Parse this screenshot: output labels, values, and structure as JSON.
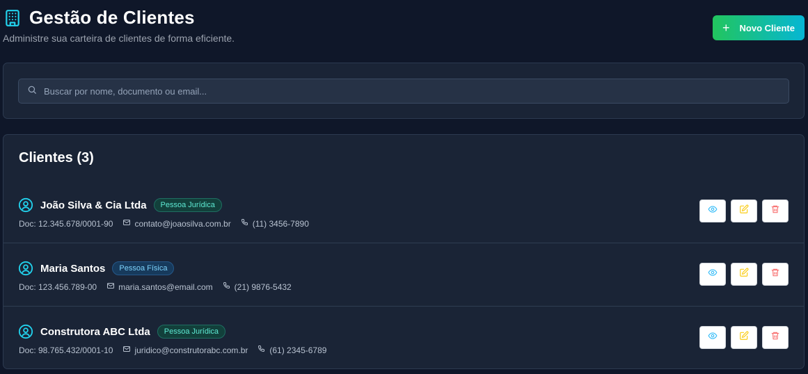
{
  "header": {
    "title": "Gestão de Clientes",
    "subtitle": "Administre sua carteira de clientes de forma eficiente.",
    "icon": "building-icon",
    "new_button_label": "Novo Cliente"
  },
  "search": {
    "placeholder": "Buscar por nome, documento ou email...",
    "value": ""
  },
  "list": {
    "title": "Clientes (3)",
    "clients": [
      {
        "name": "João Silva & Cia Ltda",
        "type": "Pessoa Jurídica",
        "doc": "Doc: 12.345.678/0001-90",
        "email": "contato@joaosilva.com.br",
        "phone": "(11) 3456-7890"
      },
      {
        "name": "Maria Santos",
        "type": "Pessoa Física",
        "doc": "Doc: 123.456.789-00",
        "email": "maria.santos@email.com",
        "phone": "(21) 9876-5432"
      },
      {
        "name": "Construtora ABC Ltda",
        "type": "Pessoa Jurídica",
        "doc": "Doc: 98.765.432/0001-10",
        "email": "juridico@construtorabc.com.br",
        "phone": "(61) 2345-6789"
      }
    ]
  },
  "colors": {
    "background": "#0f1729",
    "card": "#1a2436",
    "accent_green": "#22c55e",
    "accent_cyan": "#06b6d4",
    "view_icon": "#38bdf8",
    "edit_icon": "#facc15",
    "delete_icon": "#f87171"
  }
}
